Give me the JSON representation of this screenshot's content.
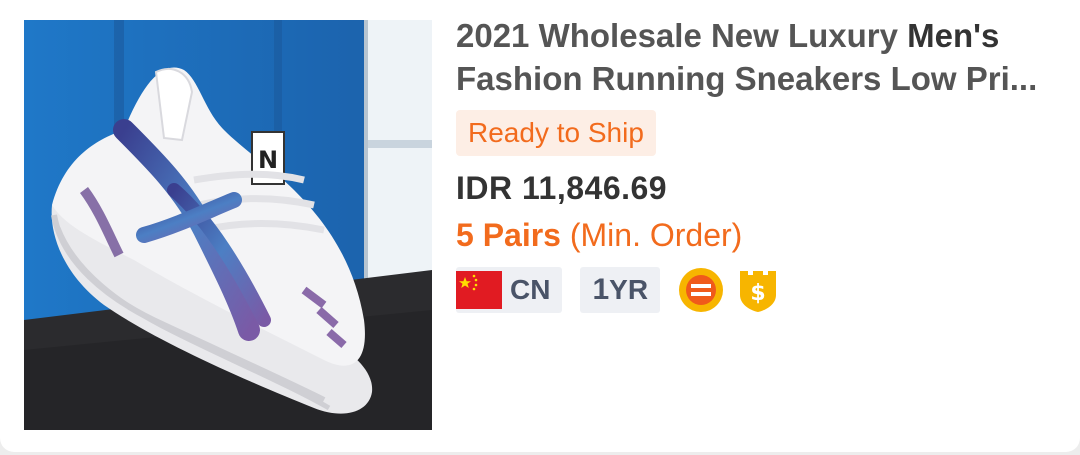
{
  "product": {
    "title_prefix": "2021 Wholesale New Luxury ",
    "title_bold": "Men's",
    "title_line2": "Fashion Running Sneakers Low Pri...",
    "badge_rts": "Ready to Ship",
    "price": "IDR 11,846.69",
    "moq_qty": "5 Pairs",
    "moq_label": "(Min. Order)",
    "image_icon": "white-blue-sneaker-photo"
  },
  "supplier": {
    "country_code": "CN",
    "years_num": "1",
    "years_unit": "YR",
    "icons": [
      "china-flag-icon",
      "trade-assurance-icon",
      "gold-supplier-shield-icon"
    ]
  },
  "colors": {
    "accent": "#f26b1d",
    "accent_bg": "#fdeee5",
    "badge_bg": "#eef0f4",
    "badge_text": "#4a5468",
    "gold": "#f7b500"
  }
}
